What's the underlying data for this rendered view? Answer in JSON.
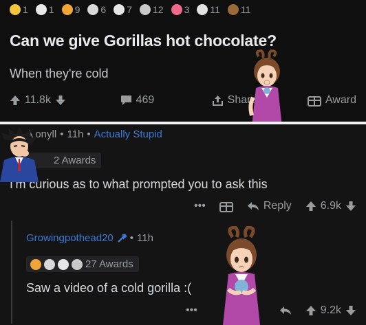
{
  "post": {
    "awards": [
      {
        "icon": "star-medal-icon",
        "count": "1",
        "color": "#f2c53d"
      },
      {
        "icon": "wholesome-icon",
        "count": "1",
        "color": "#e8e8e8"
      },
      {
        "icon": "rocket-like-icon",
        "count": "9",
        "color": "#f0a53a"
      },
      {
        "icon": "facepalm-icon",
        "count": "6",
        "color": "#d9d9d9"
      },
      {
        "icon": "laughing-icon",
        "count": "7",
        "color": "#e6e6e6"
      },
      {
        "icon": "silver-icon",
        "count": "12",
        "color": "#c9c9c9"
      },
      {
        "icon": "heart-eyes-icon",
        "count": "3",
        "color": "#ef6a8a"
      },
      {
        "icon": "sparkle-face-icon",
        "count": "11",
        "color": "#e2e2e2"
      },
      {
        "icon": "poop-icon",
        "count": "11",
        "color": "#9b6a3a"
      }
    ],
    "title": "Can we give Gorillas hot chocolate?",
    "body": "When they're cold",
    "upvotes": "11.8k",
    "comments": "469",
    "share_label": "Share",
    "award_label": "Award"
  },
  "comment1": {
    "username": "A   onyll",
    "age": "11h",
    "flair": "Actually Stupid",
    "awards_label": "2 Awards",
    "text": "I'm curious as to what prompted you to ask this",
    "reply_label": "Reply",
    "score": "6.9k",
    "more": "•••"
  },
  "comment2": {
    "username": "Growingpothead20",
    "age": "11h",
    "awards_label": "27 Awards",
    "text": "Saw a video of a cold gorilla :(",
    "score": "9.2k",
    "more": "•••"
  },
  "colors": {
    "background": "#0f0f10",
    "comment_bg": "#141415",
    "accent_blue": "#3d7ad6",
    "text_primary": "#d7dadc",
    "text_muted": "#9a9da0"
  }
}
